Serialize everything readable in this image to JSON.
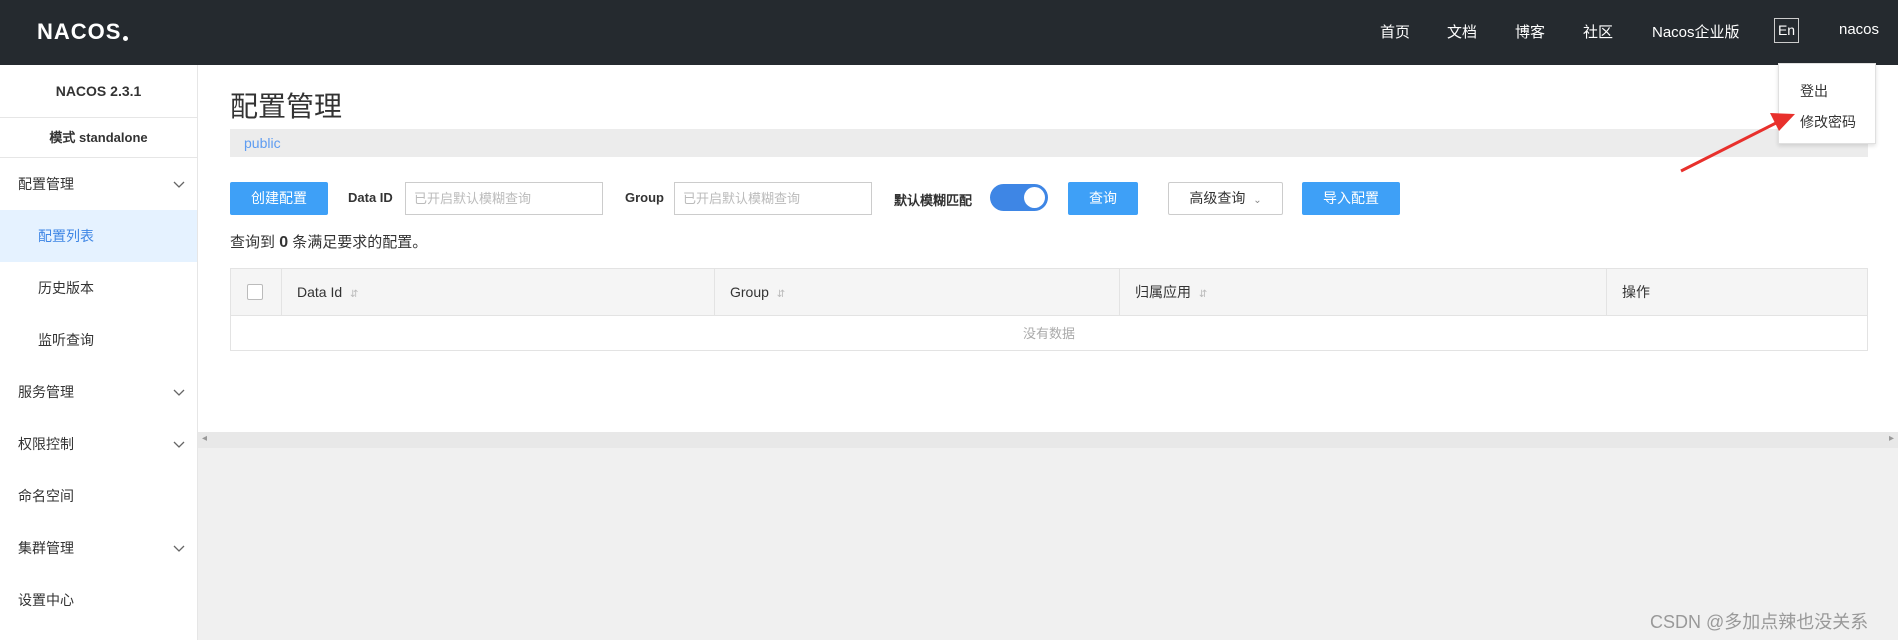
{
  "header": {
    "logo_text": "NACOS",
    "nav": [
      "首页",
      "文档",
      "博客",
      "社区",
      "Nacos企业版"
    ],
    "lang": "En",
    "user": "nacos"
  },
  "user_menu": {
    "items": [
      "登出",
      "修改密码"
    ]
  },
  "sidebar": {
    "version": "NACOS 2.3.1",
    "mode": "模式 standalone",
    "items": [
      {
        "label": "配置管理",
        "expandable": true
      },
      {
        "label": "配置列表",
        "active": true
      },
      {
        "label": "历史版本"
      },
      {
        "label": "监听查询"
      },
      {
        "label": "服务管理",
        "expandable": true
      },
      {
        "label": "权限控制",
        "expandable": true
      },
      {
        "label": "命名空间"
      },
      {
        "label": "集群管理",
        "expandable": true
      },
      {
        "label": "设置中心"
      }
    ]
  },
  "main": {
    "title": "配置管理",
    "namespace": "public",
    "create_button": "创建配置",
    "data_id_label": "Data ID",
    "data_id_placeholder": "已开启默认模糊查询",
    "group_label": "Group",
    "group_placeholder": "已开启默认模糊查询",
    "fuzzy_label": "默认模糊匹配",
    "fuzzy_enabled": true,
    "search_button": "查询",
    "advanced_button": "高级查询",
    "import_button": "导入配置",
    "result_prefix": "查询到",
    "result_count": "0",
    "result_suffix": "条满足要求的配置。",
    "table": {
      "columns": [
        "Data Id",
        "Group",
        "归属应用",
        "操作"
      ],
      "empty_text": "没有数据"
    }
  },
  "watermark": "CSDN @多加点辣也没关系",
  "colors": {
    "header_bg": "#252a2f",
    "primary": "#3ea0f7",
    "active_bg": "#e5f2ff",
    "arrow": "#e8302c"
  }
}
